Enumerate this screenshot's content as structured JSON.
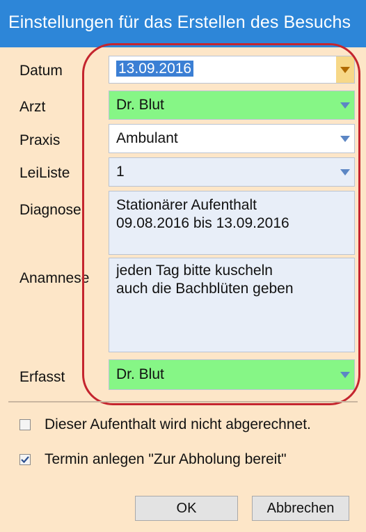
{
  "window": {
    "title": "Einstellungen für das Erstellen des Besuchs"
  },
  "form": {
    "datum_label": "Datum",
    "datum_value": "13.09.2016",
    "arzt_label": "Arzt",
    "arzt_value": "Dr. Blut",
    "praxis_label": "Praxis",
    "praxis_value": "Ambulant",
    "leiliste_label": "LeiListe",
    "leiliste_value": "1",
    "diagnose_label": "Diagnose",
    "diagnose_lines": [
      "Stationärer Aufenthalt",
      "09.08.2016 bis 13.09.2016"
    ],
    "anamnese_label": "Anamnese",
    "anamnese_lines": [
      "jeden Tag bitte kuscheln",
      "auch die Bachblüten geben"
    ],
    "erfasst_label": "Erfasst",
    "erfasst_value": "Dr. Blut"
  },
  "options": {
    "not_billed_label": "Dieser Aufenthalt wird nicht abgerechnet.",
    "not_billed_checked": false,
    "create_appointment_label": "Termin anlegen \"Zur Abholung bereit\"",
    "create_appointment_checked": true
  },
  "buttons": {
    "ok": "OK",
    "cancel": "Abbrechen"
  },
  "colors": {
    "titlebar": "#2d86d8",
    "background": "#fde6c8",
    "doctor_field": "#86f686",
    "field": "#e8eef8",
    "annotation_ring": "#c4252e",
    "selection": "#3b7fd4"
  },
  "icons": {
    "dropdown": "chevron-down-icon",
    "checkmark": "checkmark-icon"
  }
}
